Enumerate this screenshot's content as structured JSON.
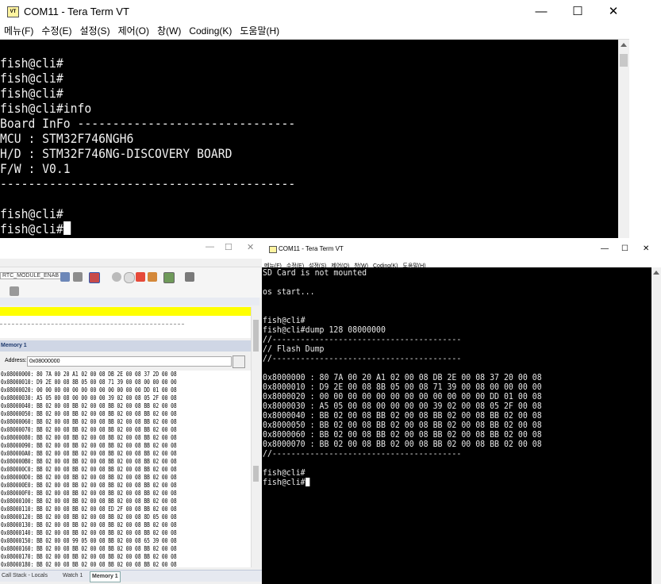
{
  "main_window": {
    "title": "COM11 - Tera Term VT",
    "icon_text": "VT",
    "minimize": "—",
    "maximize": "☐",
    "close": "✕",
    "menu": [
      "메뉴(F)",
      "수정(E)",
      "설정(S)",
      "제어(O)",
      "창(W)",
      "Coding(K)",
      "도움말(H)"
    ],
    "terminal_lines": [
      "fish@cli#",
      "fish@cli#",
      "fish@cli#",
      "fish@cli#info",
      "Board InFo -------------------------------",
      "MCU : STM32F746NGH6",
      "H/D : STM32F746NG-DISCOVERY BOARD",
      "F/W : V0.1",
      "------------------------------------------",
      "",
      "fish@cli#",
      "fish@cli#"
    ]
  },
  "ide": {
    "window_buttons": [
      "—",
      "☐",
      "✕"
    ],
    "toolbar_combo": "RTC_MODULE_ENAB",
    "memory_panel_title": "Memory 1",
    "address_label": "Address:",
    "address_value": "0x08000000",
    "memory_rows": [
      "0x08000000: 80 7A 00 20 A1 02 00 08 DB 2E 00 08 37 2D 00 08",
      "0x08000010: D9 2E 00 08 8B 05 00 08 71 39 00 08 00 00 00 00",
      "0x08000020: 00 00 00 00 00 00 00 00 00 00 00 00 DD 01 00 08",
      "0x08000030: A5 05 00 08 00 00 00 00 39 02 00 08 05 2F 00 08",
      "0x08000040: BB 02 00 08 BB 02 00 08 BB 02 00 08 BB 02 00 08",
      "0x08000050: BB 02 00 08 BB 02 00 08 BB 02 00 08 BB 02 00 08",
      "0x08000060: BB 02 00 08 BB 02 00 08 BB 02 00 08 BB 02 00 08",
      "0x08000070: BB 02 00 08 BB 02 00 08 BB 02 00 08 BB 02 00 08",
      "0x08000080: BB 02 00 08 BB 02 00 08 BB 02 00 08 BB 02 00 08",
      "0x08000090: BB 02 00 08 BB 02 00 08 BB 02 00 08 BB 02 00 08",
      "0x080000A0: BB 02 00 08 BB 02 00 08 BB 02 00 08 BB 02 00 08",
      "0x080000B0: BB 02 00 08 BB 02 00 08 BB 02 00 08 BB 02 00 08",
      "0x080000C0: BB 02 00 08 BB 02 00 08 BB 02 00 08 BB 02 00 08",
      "0x080000D0: BB 02 00 08 BB 02 00 08 BB 02 00 08 BB 02 00 08",
      "0x080000E0: BB 02 00 08 BB 02 00 08 BB 02 00 08 BB 02 00 08",
      "0x080000F0: BB 02 00 08 BB 02 00 08 BB 02 00 08 BB 02 00 08",
      "0x08000100: BB 02 00 08 BB 02 00 08 BB 02 00 08 BB 02 00 08",
      "0x08000110: BB 02 00 08 BB 02 00 08 ED 2F 00 08 BB 02 00 08",
      "0x08000120: BB 02 00 08 BB 02 00 08 BB 02 00 08 8D 05 00 08",
      "0x08000130: BB 02 00 08 BB 02 00 08 BB 02 00 08 BB 02 00 08",
      "0x08000140: BB 02 00 08 BB 02 00 08 BB 02 00 08 BB 02 00 08",
      "0x08000150: BB 02 00 08 99 05 00 08 BB 02 00 08 65 39 00 08",
      "0x08000160: BB 02 00 08 BB 02 00 08 BB 02 00 08 BB 02 00 08",
      "0x08000170: BB 02 00 08 BB 02 00 08 BB 02 00 08 BB 02 00 08",
      "0x08000180: BB 02 00 08 BB 02 00 08 BB 02 00 08 BB 02 00 08"
    ],
    "bottom_tabs": [
      "Call Stack - Locals",
      "Watch 1",
      "Memory 1"
    ]
  },
  "second_window": {
    "title": "COM11 - Tera Term VT",
    "minimize": "—",
    "maximize": "☐",
    "close": "✕",
    "menu": [
      "메뉴(F)",
      "수정(E)",
      "설정(S)",
      "제어(O)",
      "창(W)",
      "Coding(K)",
      "도움말(H)"
    ],
    "terminal_lines": [
      "SD Card is not mounted",
      "",
      "os start...",
      "",
      "",
      "fish@cli#",
      "fish@cli#dump 128 08000000",
      "//----------------------------------------",
      "// Flash Dump",
      "//----------------------------------------",
      "",
      "0x8000000 : 80 7A 00 20 A1 02 00 08 DB 2E 00 08 37 20 00 08",
      "0x8000010 : D9 2E 00 08 8B 05 00 08 71 39 00 08 00 00 00 00",
      "0x8000020 : 00 00 00 00 00 00 00 00 00 00 00 00 DD 01 00 08",
      "0x8000030 : A5 05 00 08 00 00 00 00 39 02 00 08 05 2F 00 08",
      "0x8000040 : BB 02 00 08 BB 02 00 08 BB 02 00 08 BB 02 00 08",
      "0x8000050 : BB 02 00 08 BB 02 00 08 BB 02 00 08 BB 02 00 08",
      "0x8000060 : BB 02 00 08 BB 02 00 08 BB 02 00 08 BB 02 00 08",
      "0x8000070 : BB 02 00 08 BB 02 00 08 BB 02 00 08 BB 02 00 08",
      "//----------------------------------------",
      "",
      "fish@cli#",
      "fish@cli#"
    ]
  }
}
